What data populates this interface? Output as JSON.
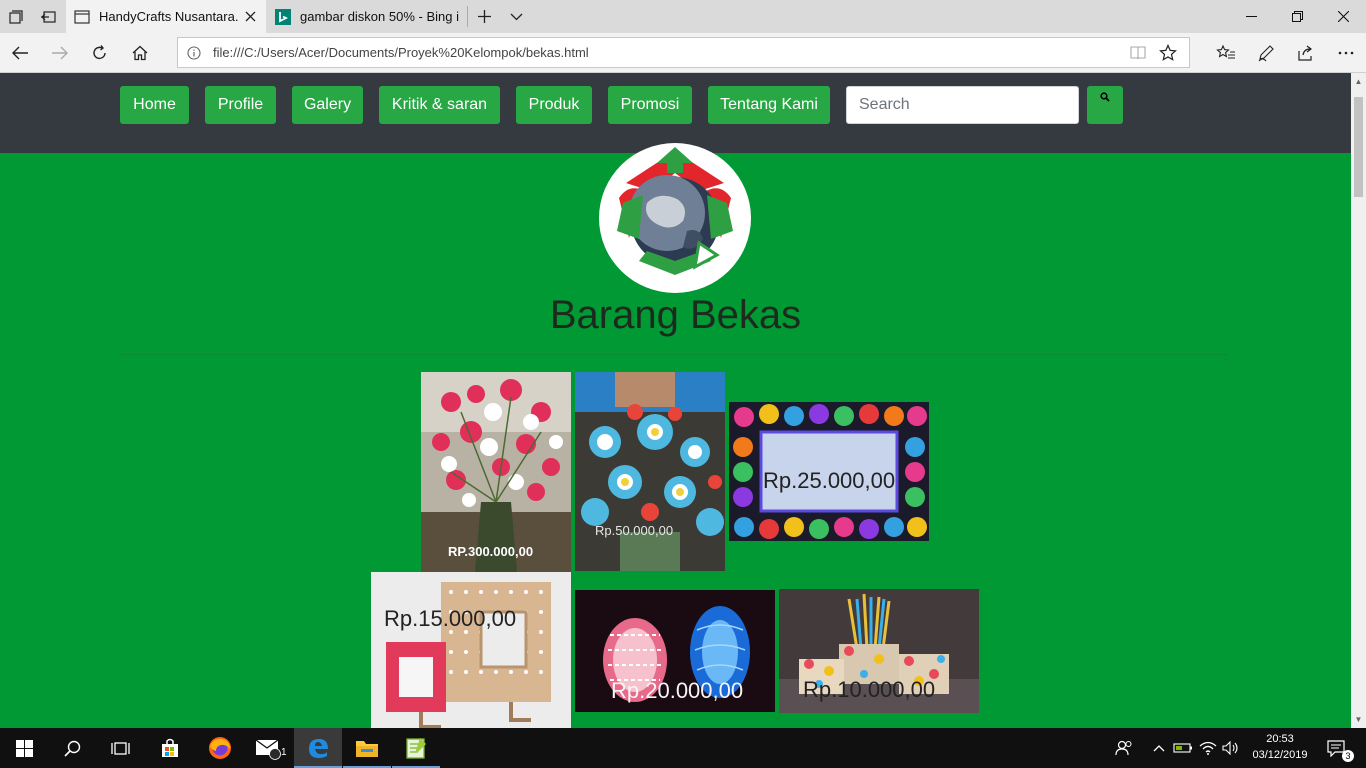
{
  "browser": {
    "tabs": [
      {
        "title": "HandyCrafts Nusantara.",
        "active": true
      },
      {
        "title": "gambar diskon 50% - Bing i",
        "active": false
      }
    ],
    "address": "file:///C:/Users/Acer/Documents/Proyek%20Kelompok/bekas.html"
  },
  "site": {
    "menu": [
      "Home",
      "Profile",
      "Galery",
      "Kritik & saran",
      "Produk",
      "Promosi",
      "Tentang Kami"
    ],
    "search_placeholder": "Search",
    "title": "Barang Bekas",
    "products": [
      {
        "name": "flower-vase",
        "price": "RP.300.000,00"
      },
      {
        "name": "bottle-flower-bouquet",
        "price": "Rp.50.000,00"
      },
      {
        "name": "quilling-photo-frame",
        "price": "Rp.25.000,00"
      },
      {
        "name": "wooden-photo-frame",
        "price": "Rp.15.000,00"
      },
      {
        "name": "spoon-lamp",
        "price": "Rp.20.000,00"
      },
      {
        "name": "bottle-pencil-holder",
        "price": "Rp.10.000,00"
      }
    ]
  },
  "taskbar": {
    "mail_badge": "1",
    "time": "20:53",
    "date": "03/12/2019",
    "notification_count": "3"
  },
  "colors": {
    "page_bg": "#009933",
    "nav_bg": "#343a40",
    "button": "#28a745"
  }
}
